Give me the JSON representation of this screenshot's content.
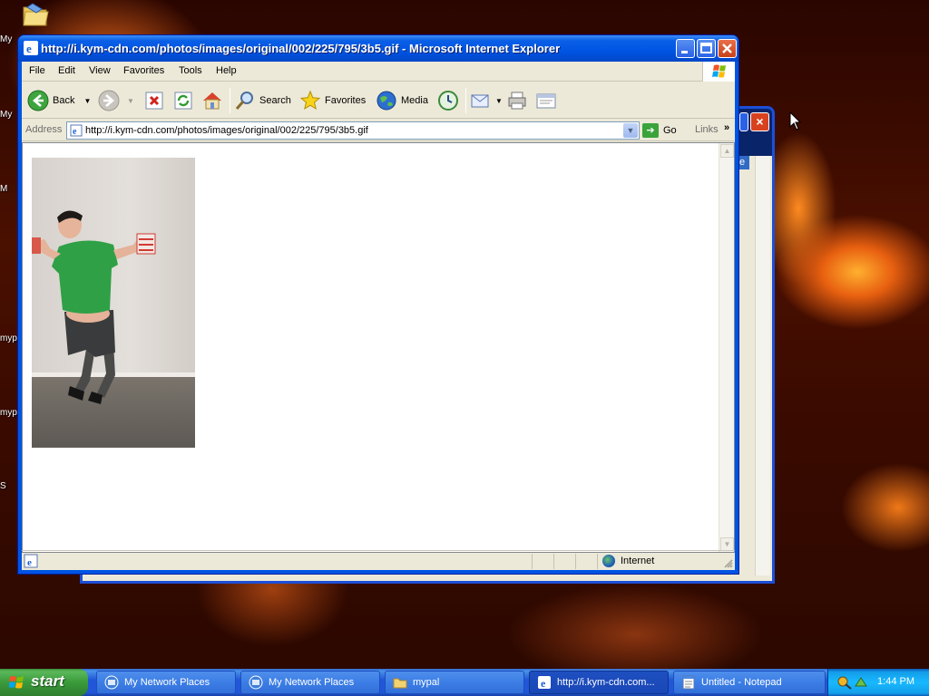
{
  "desktop": {
    "icons": [
      {
        "label": "My"
      },
      {
        "label": "My"
      },
      {
        "label": "M"
      },
      {
        "label": "myp"
      },
      {
        "label": "myp"
      },
      {
        "label": "S"
      }
    ]
  },
  "ie": {
    "title": "http://i.kym-cdn.com/photos/images/original/002/225/795/3b5.gif - Microsoft Internet Explorer",
    "menu": [
      "File",
      "Edit",
      "View",
      "Favorites",
      "Tools",
      "Help"
    ],
    "toolbar": {
      "back": "Back",
      "search": "Search",
      "favorites": "Favorites",
      "media": "Media"
    },
    "address": {
      "label": "Address",
      "url": "http://i.kym-cdn.com/photos/images/original/002/225/795/3b5.gif",
      "go": "Go",
      "links": "Links",
      "links_chevron": "»"
    },
    "status": {
      "zone": "Internet"
    }
  },
  "back_window": {
    "selected_char": "e"
  },
  "taskbar": {
    "start": "start",
    "tasks": [
      {
        "label": "My Network Places",
        "icon": "network-places-icon"
      },
      {
        "label": "My Network Places",
        "icon": "network-places-icon"
      },
      {
        "label": "mypal",
        "icon": "folder-icon"
      },
      {
        "label": "http://i.kym-cdn.com...",
        "icon": "ie-icon",
        "active": true
      },
      {
        "label": "Untitled - Notepad",
        "icon": "notepad-icon"
      }
    ],
    "clock": "1:44 PM"
  },
  "colors": {
    "title_blue": "#0054e3",
    "start_green": "#3a9a3a",
    "tray_blue": "#18b9ff"
  }
}
